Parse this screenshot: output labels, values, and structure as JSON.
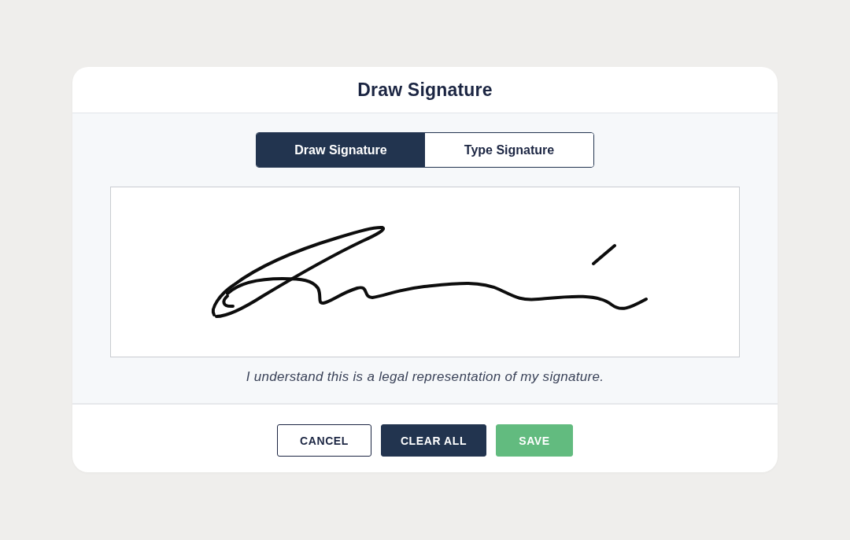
{
  "dialog": {
    "title": "Draw Signature"
  },
  "tabs": [
    {
      "label": "Draw Signature",
      "selected": true
    },
    {
      "label": "Type Signature",
      "selected": false
    }
  ],
  "signature_pad": {
    "signed": true
  },
  "disclaimer": "I understand this is a legal representation of my signature.",
  "buttons": [
    {
      "label": "CANCEL",
      "kind": "outline"
    },
    {
      "label": "CLEAR ALL",
      "kind": "primary"
    },
    {
      "label": "SAVE",
      "kind": "success"
    }
  ]
}
